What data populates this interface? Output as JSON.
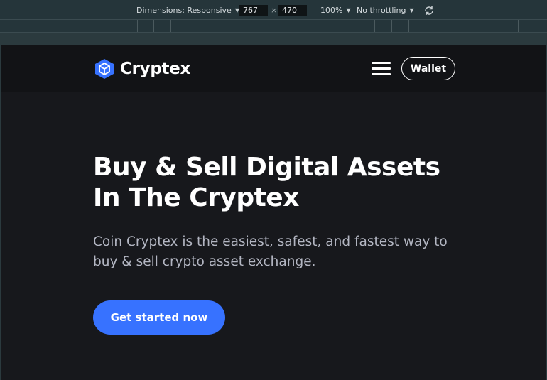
{
  "devtools": {
    "dimensions_label": "Dimensions: Responsive",
    "width_value": "767",
    "times_sign": "×",
    "height_value": "470",
    "zoom": "100%",
    "throttling": "No throttling",
    "caret": "▼"
  },
  "navbar": {
    "logo_text": "Cryptex",
    "wallet_label": "Wallet"
  },
  "hero": {
    "title_line1": "Buy & Sell Digital Assets",
    "title_line2": "In The Cryptex",
    "subtitle_line1": "Coin Cryptex is the easiest, safest, and fastest way to",
    "subtitle_line2": "buy & sell crypto asset exchange.",
    "cta_label": "Get started now"
  },
  "colors": {
    "accent": "#3772ff",
    "page_bg": "#17181c",
    "navbar_bg": "#121316",
    "subtitle_text": "#b3b6c2"
  }
}
